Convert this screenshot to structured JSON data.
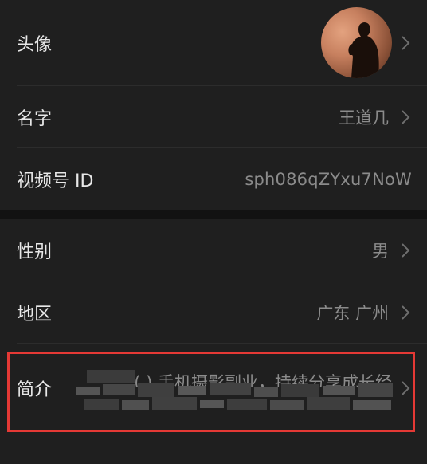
{
  "profile": {
    "avatar": {
      "label": "头像",
      "image": "person-silhouette-avatar"
    },
    "name": {
      "label": "名字",
      "value": "王道几"
    },
    "channel_id": {
      "label": "视频号 ID",
      "value": "sph086qZYxu7NoW"
    },
    "gender": {
      "label": "性别",
      "value": "男"
    },
    "region": {
      "label": "地区",
      "value": "广东 广州"
    },
    "bio": {
      "label": "简介",
      "value": "(   ) 手机摄影副业，持续分享成长经"
    }
  },
  "icons": {
    "chevron": "chevron-right-icon"
  },
  "colors": {
    "background": "#191919",
    "row_background": "#1f1f1f",
    "label": "#e8e8e8",
    "value": "#8b8b8b",
    "highlight_border": "#e53935"
  }
}
